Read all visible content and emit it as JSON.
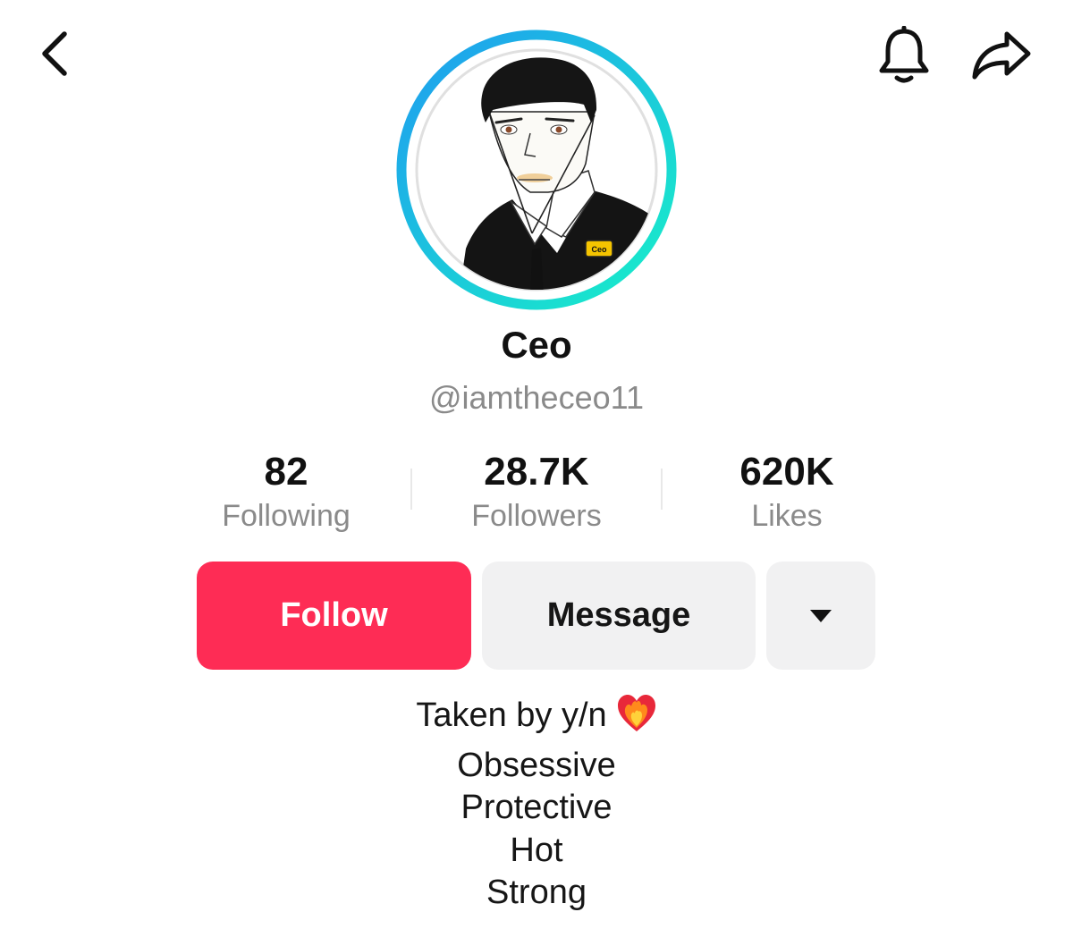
{
  "profile": {
    "name": "Ceo",
    "handle": "@iamtheceo11",
    "avatar_badge": "Ceo"
  },
  "stats": [
    {
      "value": "82",
      "label": "Following"
    },
    {
      "value": "28.7K",
      "label": "Followers"
    },
    {
      "value": "620K",
      "label": "Likes"
    }
  ],
  "actions": {
    "follow_label": "Follow",
    "message_label": "Message",
    "more_icon": "dropdown-triangle-icon"
  },
  "bio": {
    "lines": [
      "Taken by y/n",
      "Obsessive",
      "Protective",
      "Hot",
      "Strong"
    ],
    "emoji": "heart-on-fire-emoji"
  },
  "icons": {
    "back": "back-chevron-icon",
    "bell": "bell-icon",
    "share": "share-arrow-icon"
  },
  "colors": {
    "follow_button": "#fe2c55",
    "ring_start": "#1f9cf0",
    "ring_end": "#18f0c8",
    "secondary_button": "#f1f1f2",
    "muted_text": "#8a8a8a"
  }
}
